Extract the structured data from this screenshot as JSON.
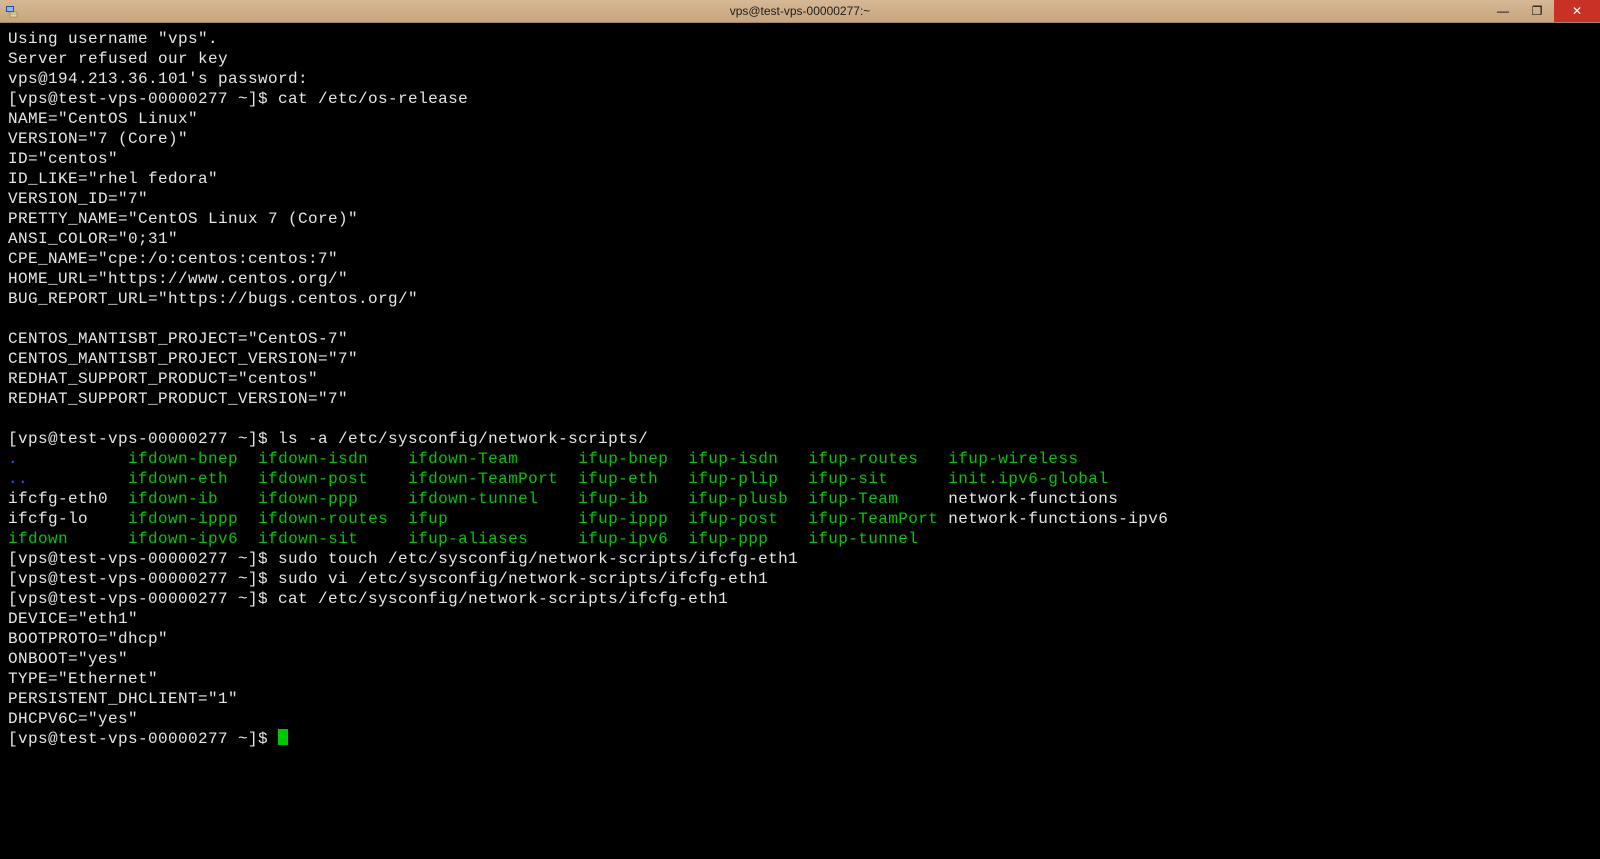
{
  "window": {
    "title": "vps@test-vps-00000277:~",
    "app_icon": "putty-icon",
    "controls": {
      "minimize": "—",
      "maximize": "❐",
      "close": "✕"
    }
  },
  "colors": {
    "term_fg": "#e6e6e6",
    "term_bg": "#000000",
    "green": "#00c800",
    "blue": "#1060ff",
    "titlebar": "#ccaa82",
    "close_bg": "#c83224"
  },
  "session": {
    "login": [
      "Using username \"vps\".",
      "Server refused our key",
      "vps@194.213.36.101's password:"
    ],
    "prompt": "[vps@test-vps-00000277 ~]$ ",
    "cmd_os_release": "cat /etc/os-release",
    "os_release": [
      "NAME=\"CentOS Linux\"",
      "VERSION=\"7 (Core)\"",
      "ID=\"centos\"",
      "ID_LIKE=\"rhel fedora\"",
      "VERSION_ID=\"7\"",
      "PRETTY_NAME=\"CentOS Linux 7 (Core)\"",
      "ANSI_COLOR=\"0;31\"",
      "CPE_NAME=\"cpe:/o:centos:centos:7\"",
      "HOME_URL=\"https://www.centos.org/\"",
      "BUG_REPORT_URL=\"https://bugs.centos.org/\"",
      "",
      "CENTOS_MANTISBT_PROJECT=\"CentOS-7\"",
      "CENTOS_MANTISBT_PROJECT_VERSION=\"7\"",
      "REDHAT_SUPPORT_PRODUCT=\"centos\"",
      "REDHAT_SUPPORT_PRODUCT_VERSION=\"7\"",
      ""
    ],
    "cmd_ls": "ls -a /etc/sysconfig/network-scripts/",
    "ls_cols": [
      [
        ".",
        "..",
        "ifcfg-eth0",
        "ifcfg-lo",
        "ifdown"
      ],
      [
        "ifdown-bnep",
        "ifdown-eth",
        "ifdown-ib",
        "ifdown-ippp",
        "ifdown-ipv6"
      ],
      [
        "ifdown-isdn",
        "ifdown-post",
        "ifdown-ppp",
        "ifdown-routes",
        "ifdown-sit"
      ],
      [
        "ifdown-Team",
        "ifdown-TeamPort",
        "ifdown-tunnel",
        "ifup",
        "ifup-aliases"
      ],
      [
        "ifup-bnep",
        "ifup-eth",
        "ifup-ib",
        "ifup-ippp",
        "ifup-ipv6"
      ],
      [
        "ifup-isdn",
        "ifup-plip",
        "ifup-plusb",
        "ifup-post",
        "ifup-ppp"
      ],
      [
        "ifup-routes",
        "ifup-sit",
        "ifup-Team",
        "ifup-TeamPort",
        "ifup-tunnel"
      ],
      [
        "ifup-wireless",
        "init.ipv6-global",
        "network-functions",
        "network-functions-ipv6",
        ""
      ]
    ],
    "ls_color": {
      "blue": [
        ".",
        ".."
      ],
      "green": [
        "ifdown-bnep",
        "ifdown-eth",
        "ifdown-ib",
        "ifdown-ippp",
        "ifdown-ipv6",
        "ifdown-isdn",
        "ifdown-post",
        "ifdown-ppp",
        "ifdown-routes",
        "ifdown-sit",
        "ifdown-Team",
        "ifdown-TeamPort",
        "ifdown-tunnel",
        "ifup-aliases",
        "ifup-bnep",
        "ifup-eth",
        "ifup-ib",
        "ifup-ippp",
        "ifup-ipv6",
        "ifup-isdn",
        "ifup-plip",
        "ifup-plusb",
        "ifup-post",
        "ifup-ppp",
        "ifup-routes",
        "ifup-sit",
        "ifup-Team",
        "ifup-TeamPort",
        "ifup-tunnel",
        "ifup-wireless",
        "init.ipv6-global",
        "ifdown",
        "ifup"
      ],
      "white": [
        "ifcfg-eth0",
        "ifcfg-lo",
        "network-functions",
        "network-functions-ipv6"
      ]
    },
    "ls_col_widths": [
      12,
      13,
      15,
      17,
      11,
      12,
      14,
      22
    ],
    "cmd_touch": "sudo touch /etc/sysconfig/network-scripts/ifcfg-eth1",
    "cmd_vi": "sudo vi /etc/sysconfig/network-scripts/ifcfg-eth1",
    "cmd_cat2": "cat /etc/sysconfig/network-scripts/ifcfg-eth1",
    "ifcfg_eth1": [
      "DEVICE=\"eth1\"",
      "BOOTPROTO=\"dhcp\"",
      "ONBOOT=\"yes\"",
      "TYPE=\"Ethernet\"",
      "PERSISTENT_DHCLIENT=\"1\"",
      "DHCPV6C=\"yes\""
    ]
  }
}
